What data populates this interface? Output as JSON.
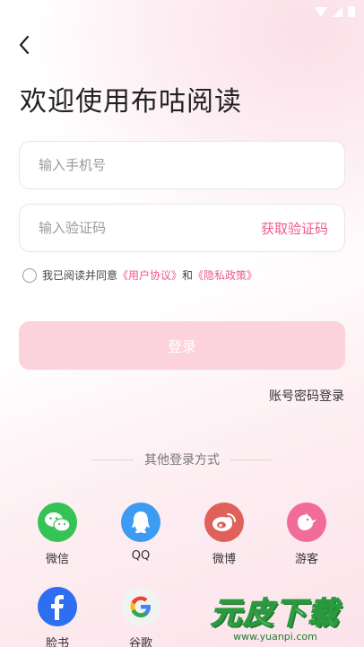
{
  "header": {
    "title": "欢迎使用布咕阅读"
  },
  "form": {
    "phone_placeholder": "输入手机号",
    "code_placeholder": "输入验证码",
    "get_code_label": "获取验证码",
    "agree_prefix": "我已阅读并同意",
    "user_agreement": "《用户协议》",
    "and": "和",
    "privacy_policy": "《隐私政策》",
    "login_label": "登录",
    "password_login_label": "账号密码登录"
  },
  "other_login": {
    "divider_label": "其他登录方式",
    "methods": [
      {
        "label": "微信",
        "icon": "wechat-icon",
        "color": "#35c356"
      },
      {
        "label": "QQ",
        "icon": "qq-icon",
        "color": "#3d9bf2"
      },
      {
        "label": "微博",
        "icon": "weibo-icon",
        "color": "#e0615a"
      },
      {
        "label": "游客",
        "icon": "guest-bird-icon",
        "color": "#f26c9a"
      },
      {
        "label": "脸书",
        "icon": "facebook-icon",
        "color": "#2d6ff0"
      },
      {
        "label": "谷歌",
        "icon": "google-icon",
        "color": "#f2f2f2"
      }
    ]
  },
  "watermark": {
    "text": "元皮下载",
    "url": "www.yuanpi.com"
  }
}
